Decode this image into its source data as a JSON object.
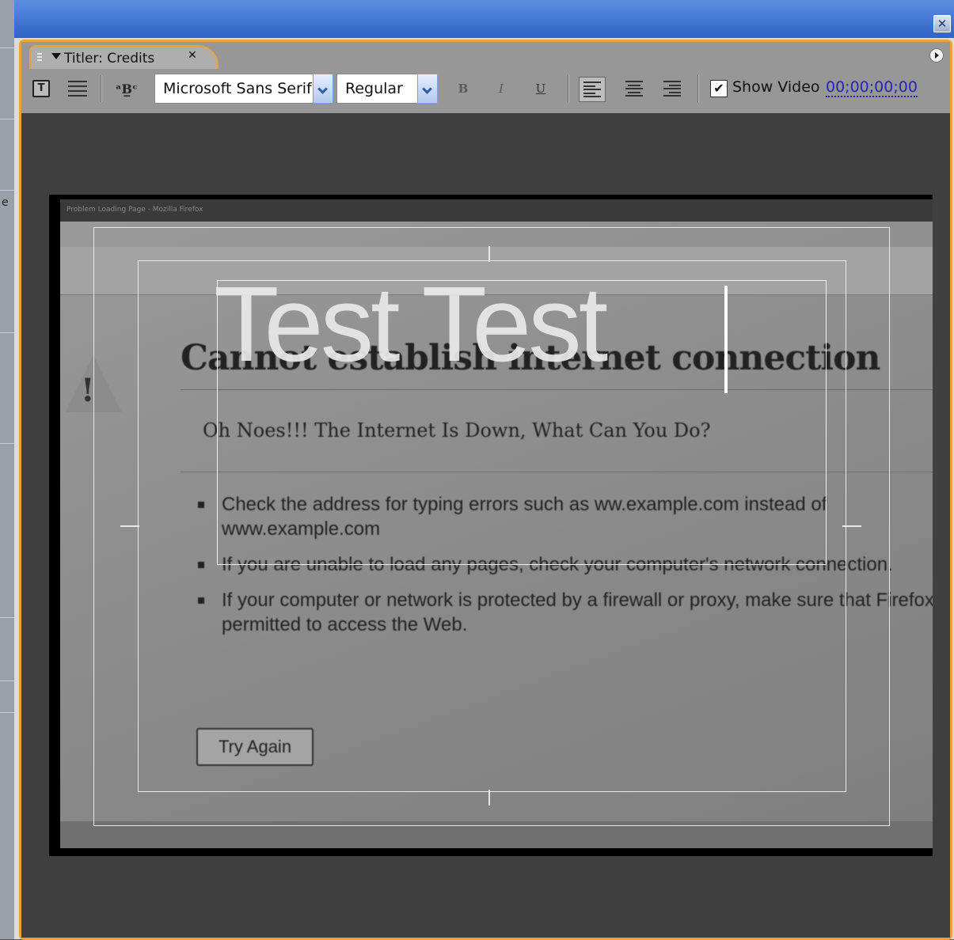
{
  "window": {
    "close_label": "✕"
  },
  "panel": {
    "tab_title": "Titler: Credits",
    "tab_close": "✕"
  },
  "toolbar": {
    "font_family": "Microsoft Sans Serif",
    "font_style": "Regular",
    "bold_label": "B",
    "italic_label": "I",
    "underline_label": "U",
    "show_video_checked": true,
    "show_video_label": "Show Video",
    "timecode": "00;00;00;00"
  },
  "titler": {
    "title_text": "Test Test"
  },
  "video_frame": {
    "browser_bar_text": "Problem Loading Page - Mozilla Firefox",
    "heading": "Cannot establish internet connection",
    "subheading": "Oh Noes!!! The Internet Is Down, What Can You Do?",
    "bullets": [
      "Check the address for typing errors such as ww.example.com instead of www.example.com",
      "If you are unable to load any pages, check your computer's network connection.",
      "If your computer or network is protected by a firewall or proxy, make sure that Firefox is permitted to access the Web."
    ],
    "button_label": "Try Again"
  }
}
